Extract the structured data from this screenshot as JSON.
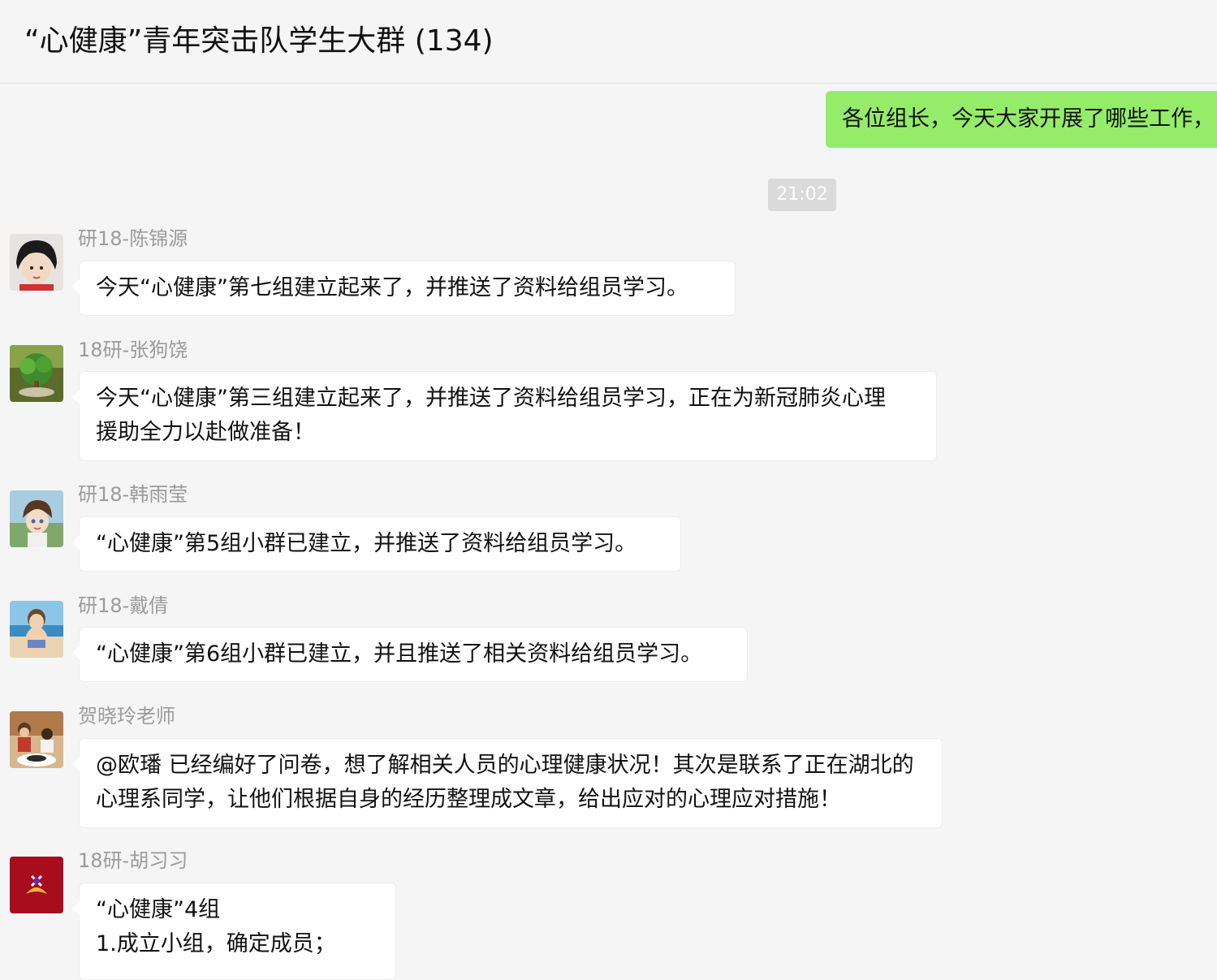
{
  "chat": {
    "title": "“心健康”青年突击队学生大群 (134)",
    "outgoing_message": "各位组长，今天大家开展了哪些工作，",
    "timestamp": "21:02"
  },
  "messages": [
    {
      "sender": "研18-陈锦源",
      "lines": [
        "今天“心健康”第七组建立起来了，并推送了资料给组员学习。"
      ]
    },
    {
      "sender": "18研-张狗饶",
      "lines": [
        "今天“心健康”第三组建立起来了，并推送了资料给组员学习，正在为新冠肺炎心理",
        "援助全力以赴做准备！"
      ]
    },
    {
      "sender": "研18-韩雨莹",
      "lines": [
        "“心健康”第5组小群已建立，并推送了资料给组员学习。"
      ]
    },
    {
      "sender": "研18-戴倩",
      "lines": [
        "“心健康”第6组小群已建立，并且推送了相关资料给组员学习。"
      ]
    },
    {
      "sender": "贺晓玲老师",
      "lines": [
        "@欧璠 已经编好了问卷，想了解相关人员的心理健康状况！其次是联系了正在湖北的",
        "心理系同学，让他们根据自身的经历整理成文章，给出应对的心理应对措施！"
      ]
    },
    {
      "sender": "18研-胡习习",
      "lines": [
        "“心健康”4组",
        "1.成立小组，确定成员；"
      ]
    }
  ],
  "colors": {
    "outgoing_bubble": "#95ec69",
    "incoming_bubble": "#ffffff",
    "background": "#f5f5f5",
    "sender_name": "#9b9b9b"
  }
}
